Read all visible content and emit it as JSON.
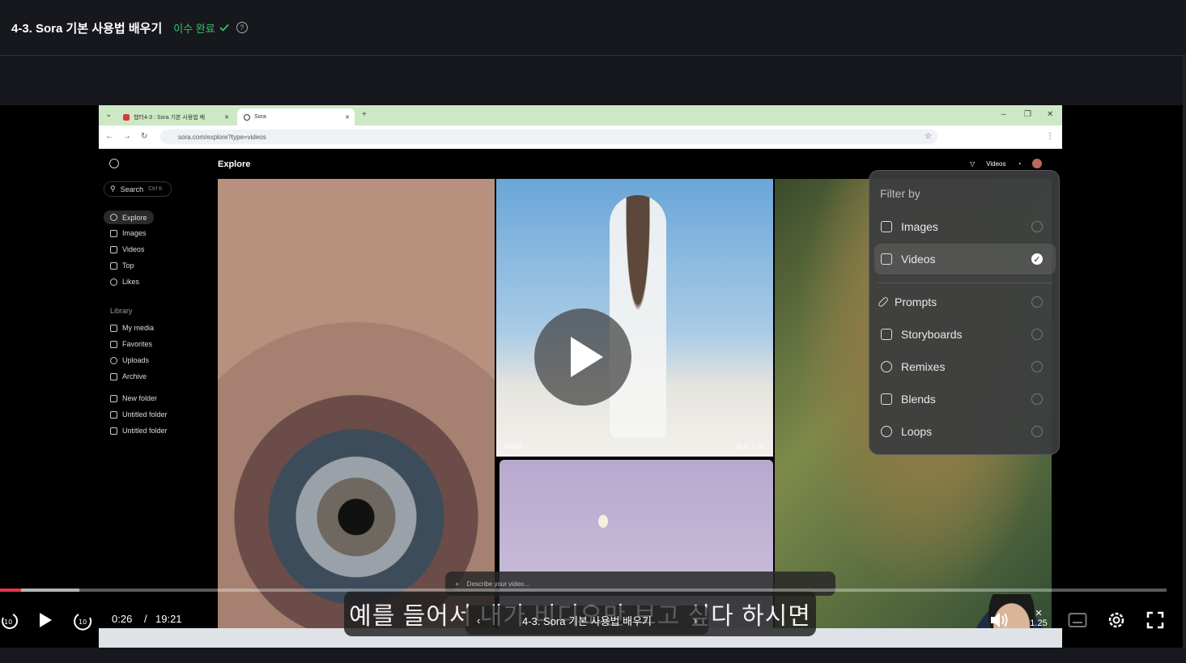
{
  "header": {
    "title": "4-3. Sora 기본 사용법 배우기",
    "status": "이수 완료"
  },
  "browser": {
    "tab1": "챕터4-3 : Sora 기본 사용법 배",
    "tab2": "Sora",
    "url": "sora.com/explore?type=videos"
  },
  "sora": {
    "search": "Search",
    "search_shortcut": "Ctrl K",
    "nav": [
      "Explore",
      "Images",
      "Videos",
      "Top",
      "Likes"
    ],
    "library_label": "Library",
    "library": [
      "My media",
      "Favorites",
      "Uploads",
      "Archive"
    ],
    "folders": [
      "New folder",
      "Untitled folder",
      "Untitled folder"
    ],
    "page_title": "Explore",
    "top_filter": "Videos",
    "card_user": "hazini",
    "card_likes": "67",
    "describe_placeholder": "Describe your video..."
  },
  "filter": {
    "title": "Filter by",
    "items": [
      {
        "label": "Images",
        "checked": false
      },
      {
        "label": "Videos",
        "checked": true
      },
      {
        "label": "Prompts",
        "checked": false
      },
      {
        "label": "Storyboards",
        "checked": false
      },
      {
        "label": "Remixes",
        "checked": false
      },
      {
        "label": "Blends",
        "checked": false
      },
      {
        "label": "Loops",
        "checked": false
      }
    ]
  },
  "player": {
    "subtitle": "예를 들어서 내가 비디오만 보고 싶다 하시면",
    "current_time": "0:26",
    "separator": "/",
    "total_time": "19:21",
    "lesson_title": "4-3. Sora 기본 사용법 배우기",
    "speed": "1.25",
    "progress_fraction": 0.018,
    "buffer_fraction": 0.068,
    "accent": "#e5334a"
  },
  "icons": [
    "rewind-10-icon",
    "play-icon",
    "forward-10-icon",
    "volume-icon",
    "speed-icon",
    "subtitle-icon",
    "settings-icon",
    "fullscreen-icon",
    "checkmark-icon",
    "help-icon"
  ]
}
